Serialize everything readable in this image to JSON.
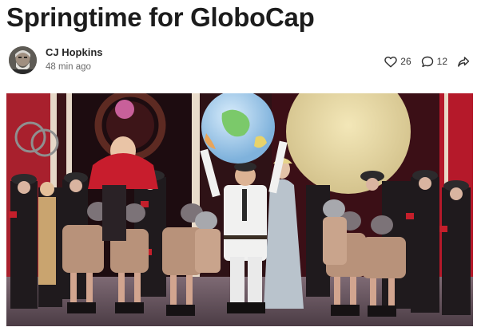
{
  "post": {
    "title": "Springtime for GloboCap",
    "author": "CJ Hopkins",
    "time_ago": "48 min ago"
  },
  "engagement": {
    "likes": "26",
    "comments": "12"
  },
  "icons": {
    "like": "heart-icon",
    "comment": "comment-bubble-icon",
    "share": "share-arrow-icon"
  },
  "colors": {
    "title": "#1c1c1c",
    "meta": "#6b6b6b",
    "stage_red": "#b5192a"
  }
}
